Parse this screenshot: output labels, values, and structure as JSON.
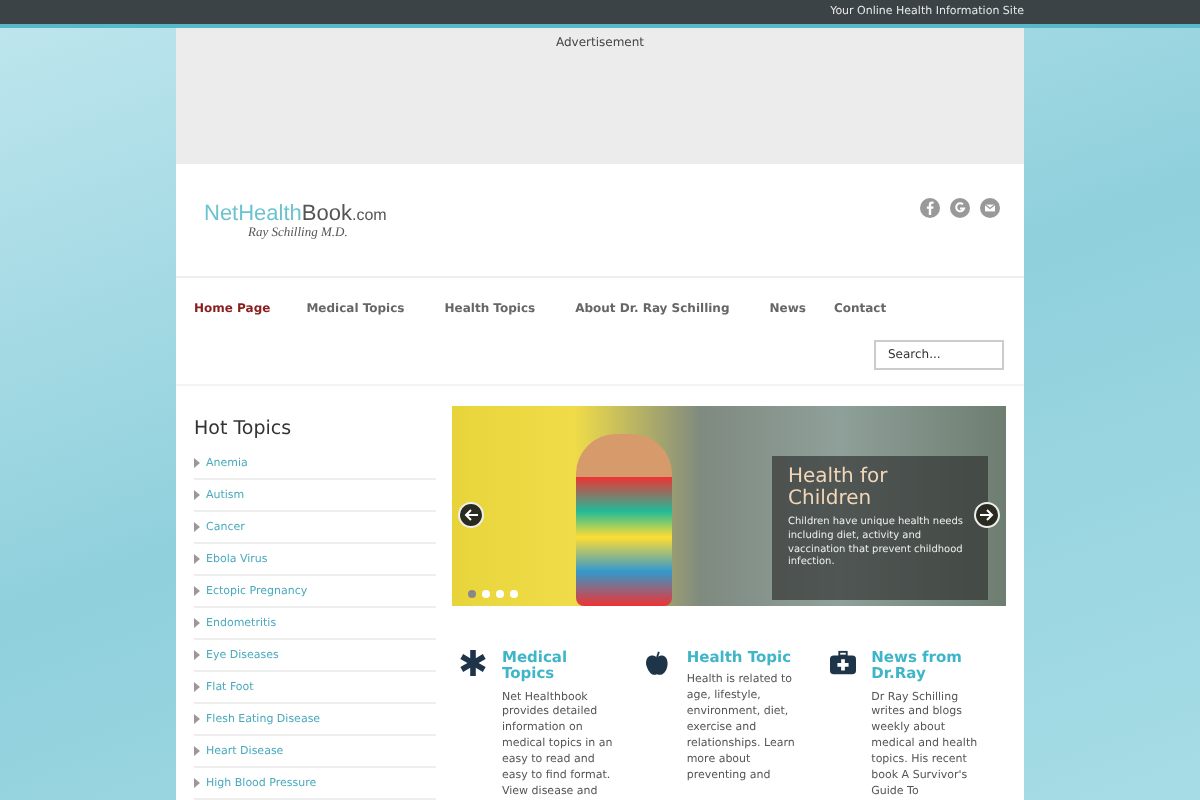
{
  "top_bar": {
    "tagline": "Your Online Health Information Site"
  },
  "ad": {
    "label": "Advertisement"
  },
  "header": {
    "logo_light": "NetHealth",
    "logo_dark": "Book",
    "logo_suffix": ".com",
    "logo_byline": "Ray Schilling M.D.",
    "social": [
      {
        "kind": "facebook"
      },
      {
        "kind": "google"
      },
      {
        "kind": "mail"
      }
    ]
  },
  "nav": [
    {
      "label": "Home Page",
      "selected": true
    },
    {
      "label": "Medical Topics",
      "selected": false
    },
    {
      "label": "Health Topics",
      "selected": false
    },
    {
      "label": "About Dr. Ray Schilling",
      "selected": false
    },
    {
      "label": "News",
      "selected": false
    },
    {
      "label": "Contact",
      "selected": false
    }
  ],
  "search": {
    "placeholder": "Search..."
  },
  "sidebar": {
    "title": "Hot Topics",
    "items": [
      "Anemia",
      "Autism",
      "Cancer",
      "Ebola Virus",
      "Ectopic Pregnancy",
      "Endometritis",
      "Eye Diseases",
      "Flat Foot",
      "Flesh Eating Disease",
      "Heart Disease",
      "High Blood Pressure"
    ]
  },
  "slider": {
    "title": "Health for Children",
    "text": "Children have unique health needs including diet, activity and vaccination that prevent childhood infection.",
    "dots": [
      {
        "selected": true
      },
      {
        "selected": false
      },
      {
        "selected": false
      },
      {
        "selected": false
      }
    ]
  },
  "features": [
    {
      "kind": "medical",
      "title": "Medical Topics",
      "text": "Net Healthbook provides detailed information on medical topics in an easy to read and easy to find format. View disease and"
    },
    {
      "kind": "apple",
      "title": "Health Topic",
      "text": "Health is related to age, lifestyle, environment, diet, exercise and relationships. Learn more about preventing and"
    },
    {
      "kind": "kit",
      "title": "News from Dr.Ray",
      "text": "Dr Ray Schilling writes and blogs weekly about medical and health topics. His recent book A Survivor's Guide To"
    }
  ]
}
